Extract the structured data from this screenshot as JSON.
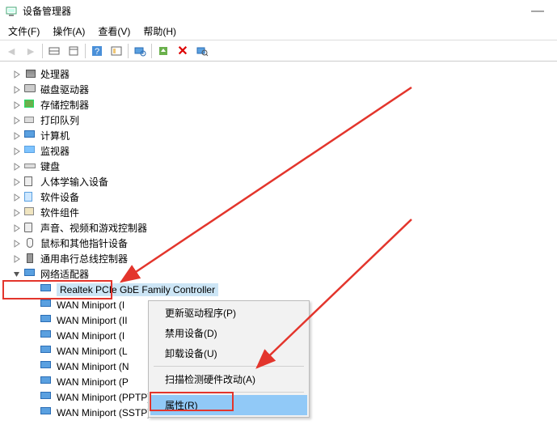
{
  "titlebar": {
    "title": "设备管理器"
  },
  "menubar": {
    "file": "文件(F)",
    "action": "操作(A)",
    "view": "查看(V)",
    "help": "帮助(H)"
  },
  "tree": {
    "nodes": [
      {
        "label": "处理器",
        "icon": "chip"
      },
      {
        "label": "磁盘驱动器",
        "icon": "disk"
      },
      {
        "label": "存储控制器",
        "icon": "ctrl"
      },
      {
        "label": "打印队列",
        "icon": "printer"
      },
      {
        "label": "计算机",
        "icon": "computer"
      },
      {
        "label": "监视器",
        "icon": "monitor"
      },
      {
        "label": "键盘",
        "icon": "keyboard"
      },
      {
        "label": "人体学输入设备",
        "icon": "hid"
      },
      {
        "label": "软件设备",
        "icon": "sw"
      },
      {
        "label": "软件组件",
        "icon": "comp"
      },
      {
        "label": "声音、视频和游戏控制器",
        "icon": "sound"
      },
      {
        "label": "鼠标和其他指针设备",
        "icon": "mouse"
      },
      {
        "label": "通用串行总线控制器",
        "icon": "usb"
      }
    ],
    "net_label": "网络适配器",
    "net_children": [
      {
        "label": "Realtek PCIe GbE Family Controller",
        "selected": true
      },
      {
        "label": "WAN Miniport (I"
      },
      {
        "label": "WAN Miniport (II"
      },
      {
        "label": "WAN Miniport (I"
      },
      {
        "label": "WAN Miniport (L"
      },
      {
        "label": "WAN Miniport (N"
      },
      {
        "label": "WAN Miniport (P"
      },
      {
        "label": "WAN Miniport (PPTP)"
      },
      {
        "label": "WAN Miniport (SSTP)"
      }
    ]
  },
  "contextmenu": {
    "update_driver": "更新驱动程序(P)",
    "disable": "禁用设备(D)",
    "uninstall": "卸载设备(U)",
    "scan": "扫描检测硬件改动(A)",
    "properties": "属性(R)"
  }
}
